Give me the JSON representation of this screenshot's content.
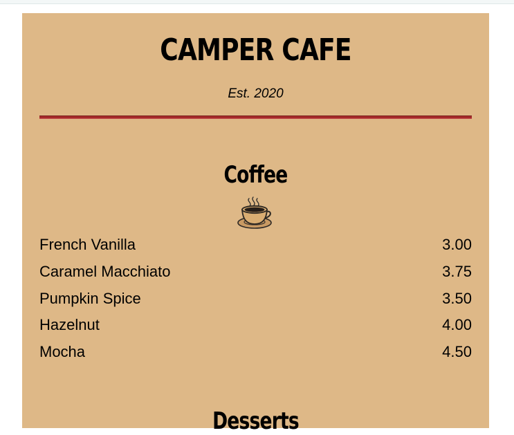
{
  "header": {
    "cafe_name": "CAMPER CAFE",
    "established": "Est. 2020"
  },
  "coffee": {
    "title": "Coffee",
    "icon": "coffee-cup-icon",
    "items": [
      {
        "name": "French Vanilla",
        "price": "3.00"
      },
      {
        "name": "Caramel Macchiato",
        "price": "3.75"
      },
      {
        "name": "Pumpkin Spice",
        "price": "3.50"
      },
      {
        "name": "Hazelnut",
        "price": "4.00"
      },
      {
        "name": "Mocha",
        "price": "4.50"
      }
    ]
  },
  "desserts": {
    "title": "Desserts"
  },
  "colors": {
    "menu_background": "#deb887",
    "divider": "#a52a2a",
    "page_background": "#ffffff"
  }
}
